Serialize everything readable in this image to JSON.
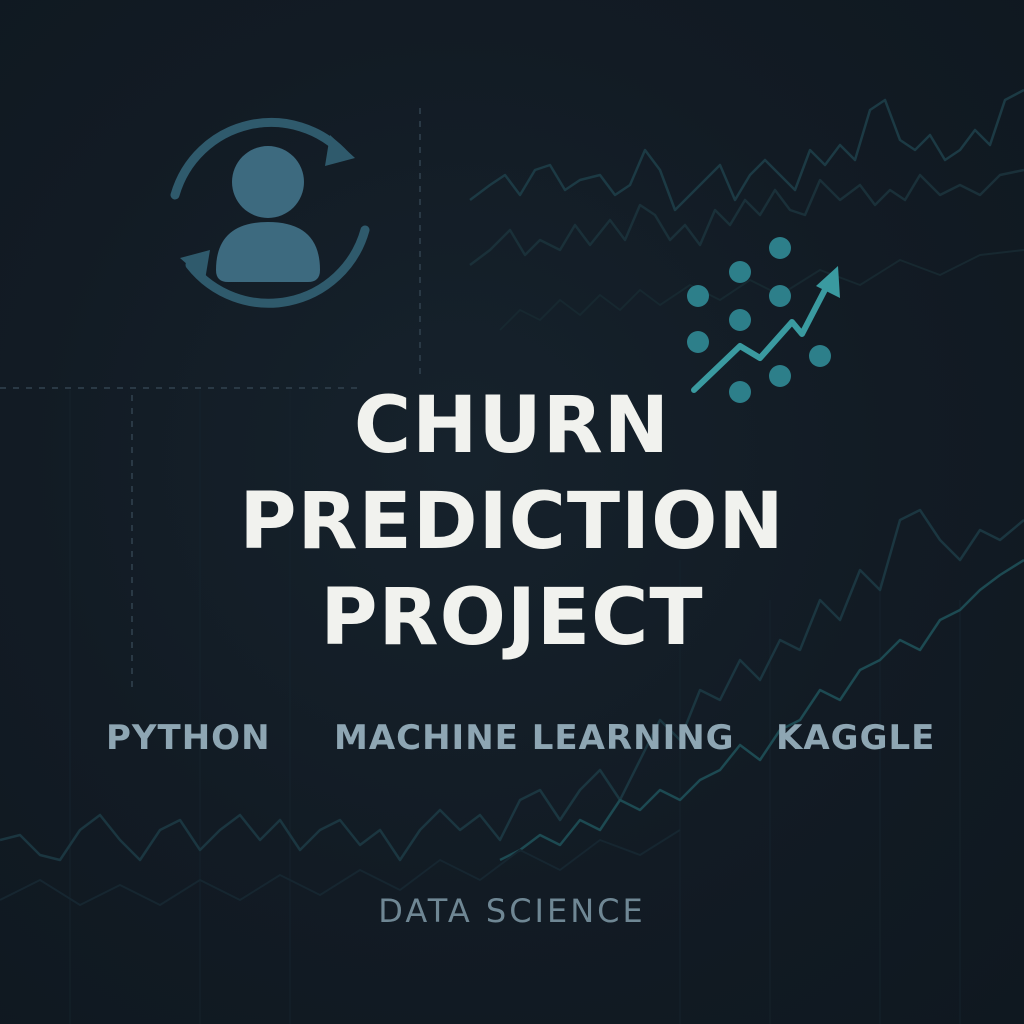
{
  "title": {
    "line1": "CHURN",
    "line2": "PREDICTION",
    "line3": "PROJECT"
  },
  "tags": [
    "PYTHON",
    "MACHINE LEARNING",
    "KAGGLE"
  ],
  "footer": "DATA SCIENCE",
  "icons": {
    "user_cycle": "user-refresh-icon",
    "scatter_trend": "scatter-trend-icon"
  },
  "colors": {
    "background": "#111a22",
    "title": "#f1f2ee",
    "tag": "#8ea6b3",
    "footer": "#6f8794",
    "accent": "#3b6a7e",
    "teal": "#2f8c92"
  }
}
